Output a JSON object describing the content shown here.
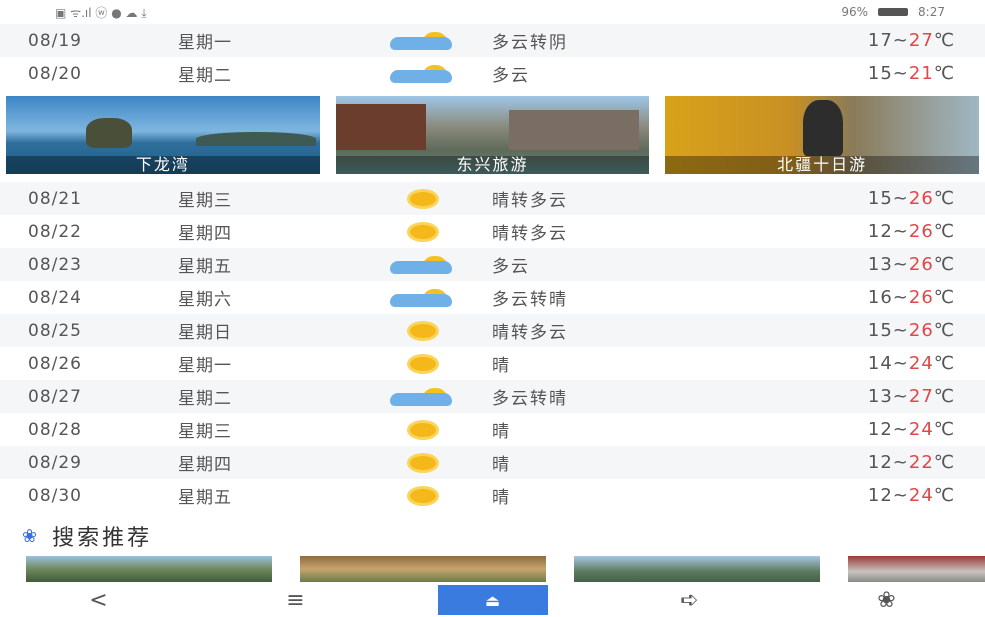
{
  "status_bar": {
    "left_glyphs": "▣ ᯤ.ıl ⓦ ● ☁ ⤓",
    "right_battery": "96%",
    "right_time": "8:27"
  },
  "forecast_top": [
    {
      "date": "08/19",
      "day": "星期一",
      "icon": "cloudy-icon",
      "desc": "多云转阴",
      "low": "17",
      "high": "27",
      "unit": "℃"
    },
    {
      "date": "08/20",
      "day": "星期二",
      "icon": "cloudy-icon",
      "desc": "多云",
      "low": "15",
      "high": "21",
      "unit": "℃"
    }
  ],
  "banners": [
    {
      "caption": "下龙湾"
    },
    {
      "caption": "东兴旅游"
    },
    {
      "caption": "北疆十日游"
    }
  ],
  "forecast": [
    {
      "date": "08/21",
      "day": "星期三",
      "icon": "sunny-icon",
      "desc": "晴转多云",
      "low": "15",
      "high": "26",
      "unit": "℃"
    },
    {
      "date": "08/22",
      "day": "星期四",
      "icon": "sunny-icon",
      "desc": "晴转多云",
      "low": "12",
      "high": "26",
      "unit": "℃"
    },
    {
      "date": "08/23",
      "day": "星期五",
      "icon": "cloudy-icon",
      "desc": "多云",
      "low": "13",
      "high": "26",
      "unit": "℃"
    },
    {
      "date": "08/24",
      "day": "星期六",
      "icon": "cloudy-icon",
      "desc": "多云转晴",
      "low": "16",
      "high": "26",
      "unit": "℃"
    },
    {
      "date": "08/25",
      "day": "星期日",
      "icon": "sunny-icon",
      "desc": "晴转多云",
      "low": "15",
      "high": "26",
      "unit": "℃"
    },
    {
      "date": "08/26",
      "day": "星期一",
      "icon": "sunny-icon",
      "desc": "晴",
      "low": "14",
      "high": "24",
      "unit": "℃"
    },
    {
      "date": "08/27",
      "day": "星期二",
      "icon": "cloudy-icon",
      "desc": "多云转晴",
      "low": "13",
      "high": "27",
      "unit": "℃"
    },
    {
      "date": "08/28",
      "day": "星期三",
      "icon": "sunny-icon",
      "desc": "晴",
      "low": "12",
      "high": "24",
      "unit": "℃"
    },
    {
      "date": "08/29",
      "day": "星期四",
      "icon": "sunny-icon",
      "desc": "晴",
      "low": "12",
      "high": "22",
      "unit": "℃"
    },
    {
      "date": "08/30",
      "day": "星期五",
      "icon": "sunny-icon",
      "desc": "晴",
      "low": "12",
      "high": "24",
      "unit": "℃"
    }
  ],
  "search_section": {
    "title": "搜索推荐",
    "icon": "paw-icon"
  },
  "nav": {
    "back": "<",
    "menu": "≡",
    "home": "⏏",
    "share": "➪",
    "paw": "❀"
  },
  "colors": {
    "high_temp": "#e24646",
    "accent_blue": "#3a7be0"
  }
}
